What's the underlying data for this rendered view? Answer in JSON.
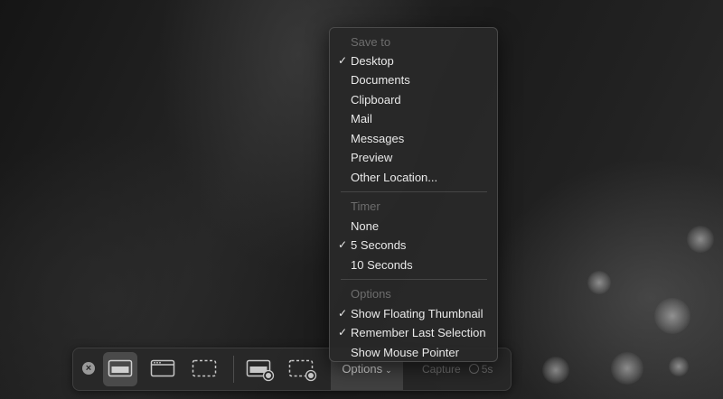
{
  "toolbar": {
    "close_icon": "×",
    "tools": [
      {
        "name": "capture-entire-screen-button",
        "icon": "screen-icon",
        "active": true
      },
      {
        "name": "capture-selected-window-button",
        "icon": "window-icon",
        "active": false
      },
      {
        "name": "capture-selected-portion-button",
        "icon": "selection-icon",
        "active": false
      },
      {
        "name": "record-entire-screen-button",
        "icon": "screen-record-icon",
        "active": false
      },
      {
        "name": "record-selected-portion-button",
        "icon": "selection-record-icon",
        "active": false
      }
    ],
    "options_label": "Options",
    "options_chevron": "⌄",
    "capture_label": "Capture",
    "capture_timer": "5s"
  },
  "menu": {
    "sections": [
      {
        "header": "Save to",
        "items": [
          {
            "label": "Desktop",
            "checked": true
          },
          {
            "label": "Documents",
            "checked": false
          },
          {
            "label": "Clipboard",
            "checked": false
          },
          {
            "label": "Mail",
            "checked": false
          },
          {
            "label": "Messages",
            "checked": false
          },
          {
            "label": "Preview",
            "checked": false
          },
          {
            "label": "Other Location...",
            "checked": false
          }
        ]
      },
      {
        "header": "Timer",
        "items": [
          {
            "label": "None",
            "checked": false
          },
          {
            "label": "5 Seconds",
            "checked": true
          },
          {
            "label": "10 Seconds",
            "checked": false
          }
        ]
      },
      {
        "header": "Options",
        "items": [
          {
            "label": "Show Floating Thumbnail",
            "checked": true
          },
          {
            "label": "Remember Last Selection",
            "checked": true
          },
          {
            "label": "Show Mouse Pointer",
            "checked": false
          }
        ]
      }
    ],
    "check_glyph": "✓"
  }
}
